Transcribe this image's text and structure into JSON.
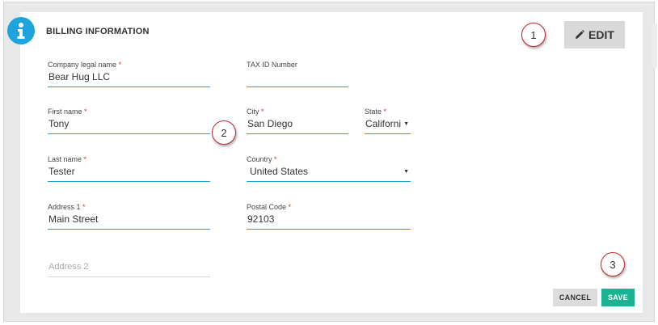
{
  "header": {
    "title": "BILLING INFORMATION",
    "info_icon": "info-icon",
    "edit_label": "EDIT",
    "edit_icon": "pencil-icon"
  },
  "form": {
    "company_name": {
      "label": "Company legal name",
      "required": "*",
      "value": "Bear Hug LLC"
    },
    "tax_id": {
      "label": "TAX ID Number",
      "value": ""
    },
    "first_name": {
      "label": "First name",
      "required": "*",
      "value": "Tony"
    },
    "city": {
      "label": "City",
      "required": "*",
      "value": "San Diego"
    },
    "state": {
      "label": "State",
      "required": "*",
      "value": "Californi"
    },
    "last_name": {
      "label": "Last name",
      "required": "*",
      "value": "Tester"
    },
    "country": {
      "label": "Country",
      "required": "*",
      "value": "United States"
    },
    "address1": {
      "label": "Address 1",
      "required": "*",
      "value": "Main Street"
    },
    "postal_code": {
      "label": "Postal Code",
      "required": "*",
      "value": "92103"
    },
    "address2": {
      "placeholder": "Address 2"
    }
  },
  "actions": {
    "cancel_label": "CANCEL",
    "save_label": "SAVE"
  },
  "callouts": [
    "1",
    "2",
    "3"
  ],
  "colors": {
    "accent": "#1ea4dd",
    "save": "#1bb193",
    "callout_border": "#c0272d",
    "required": "#d9342b"
  }
}
